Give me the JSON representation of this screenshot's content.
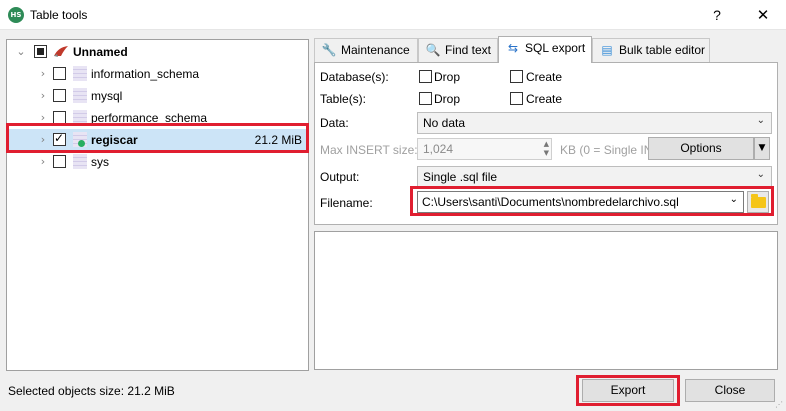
{
  "window": {
    "title": "Table tools",
    "app_icon_text": "HS",
    "help_label": "?",
    "close_label": "✕"
  },
  "tree": {
    "root": {
      "label": "Unnamed",
      "check": "partial"
    },
    "items": [
      {
        "label": "information_schema",
        "size": "",
        "check": "unchecked"
      },
      {
        "label": "mysql",
        "size": "",
        "check": "unchecked"
      },
      {
        "label": "performance_schema",
        "size": "",
        "check": "unchecked"
      },
      {
        "label": "regiscar",
        "size": "21.2 MiB",
        "check": "checked",
        "selected": true
      },
      {
        "label": "sys",
        "size": "",
        "check": "unchecked"
      }
    ]
  },
  "tabs": [
    {
      "label": "Maintenance",
      "icon": "wrench-icon"
    },
    {
      "label": "Find text",
      "icon": "magnifier-icon"
    },
    {
      "label": "SQL export",
      "icon": "export-arrows-icon",
      "active": true
    },
    {
      "label": "Bulk table editor",
      "icon": "table-stack-icon"
    }
  ],
  "sql_export": {
    "databases_label": "Database(s):",
    "tables_label": "Table(s):",
    "drop_label": "Drop",
    "create_label": "Create",
    "data_label": "Data:",
    "data_value": "No data",
    "max_insert_label": "Max INSERT size:",
    "max_insert_value": "1,024",
    "max_insert_unit": "KB (0 = Single IN",
    "options_label": "Options",
    "output_label": "Output:",
    "output_value": "Single .sql file",
    "filename_label": "Filename:",
    "filename_value": "C:\\Users\\santi\\Documents\\nombredelarchivo.sql"
  },
  "footer": {
    "status": "Selected objects size: 21.2 MiB",
    "export_label": "Export",
    "close_label": "Close"
  },
  "colors": {
    "highlight_red": "#e01e30",
    "selection_blue": "#cce4f7",
    "folder_yellow": "#f5c518"
  }
}
